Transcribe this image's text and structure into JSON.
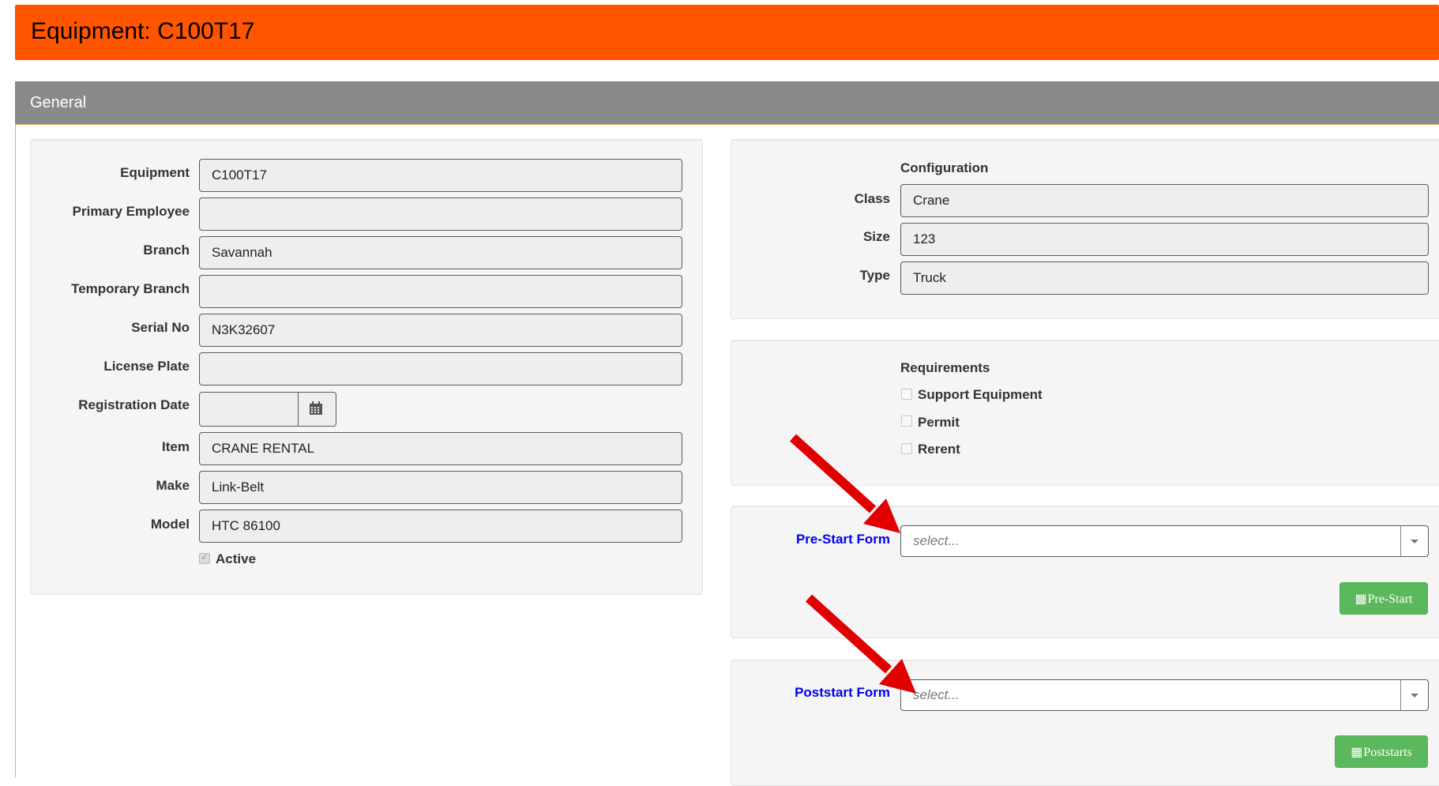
{
  "header": {
    "title": "Equipment: C100T17",
    "color": "#ff5500"
  },
  "panel": {
    "title": "General",
    "heading_color": "#888b8a"
  },
  "general": {
    "fields": [
      {
        "label": "Equipment",
        "value": "C100T17"
      },
      {
        "label": "Primary Employee",
        "value": ""
      },
      {
        "label": "Branch",
        "value": "Savannah"
      },
      {
        "label": "Temporary Branch",
        "value": ""
      },
      {
        "label": "Serial No",
        "value": "N3K32607"
      },
      {
        "label": "License Plate",
        "value": ""
      },
      {
        "label": "Registration Date",
        "value": ""
      },
      {
        "label": "Item",
        "value": "CRANE RENTAL"
      },
      {
        "label": "Make",
        "value": "Link-Belt"
      },
      {
        "label": "Model",
        "value": "HTC 86100"
      }
    ],
    "active": {
      "label": "Active",
      "checked": true
    },
    "calendar_icon": "calendar-icon"
  },
  "configuration": {
    "title": "Configuration",
    "fields": [
      {
        "label": "Class",
        "value": "Crane"
      },
      {
        "label": "Size",
        "value": "123"
      },
      {
        "label": "Type",
        "value": "Truck"
      }
    ]
  },
  "requirements": {
    "title": "Requirements",
    "items": [
      {
        "label": "Support Equipment",
        "checked": false
      },
      {
        "label": "Permit",
        "checked": false
      },
      {
        "label": "Rerent",
        "checked": false
      }
    ]
  },
  "prestart": {
    "label": "Pre-Start Form",
    "placeholder": "select...",
    "button_label": "Pre-Start",
    "button_icon": "calendar-icon"
  },
  "poststart": {
    "label": "Poststart Form",
    "placeholder": "select...",
    "button_label": "Poststarts",
    "button_icon": "calendar-icon"
  },
  "colors": {
    "accent_orange": "#ff5500",
    "button_green": "#5cb85c",
    "link_blue": "#0000ee",
    "annotation_red": "#e00000"
  }
}
